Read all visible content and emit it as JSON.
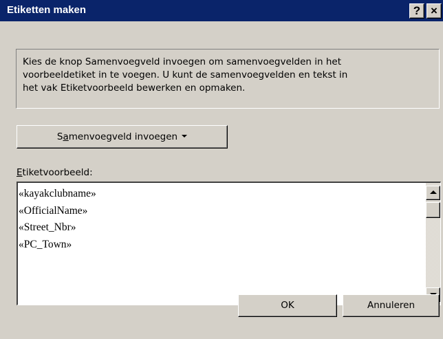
{
  "window": {
    "title": "Etiketten maken",
    "help_label": "?",
    "close_label": "×"
  },
  "info": {
    "text": "Kies de knop Samenvoegveld invoegen om samenvoegvelden in het\nvoorbeeldetiket in te voegen. U kunt de samenvoegvelden en tekst in\nhet vak Etiketvoorbeeld bewerken en opmaken."
  },
  "merge_button": {
    "label_prefix": "S",
    "label_mnemonic": "a",
    "label_rest": "menvoegveld invoegen",
    "icon": "chevron-down-icon"
  },
  "preview": {
    "label_mnemonic": "E",
    "label_rest": "tiketvoorbeeld:",
    "lines": [
      "«kayakclubname»",
      "«OfficialName»",
      "«Street_Nbr»",
      "«PC_Town»"
    ]
  },
  "buttons": {
    "ok": "OK",
    "cancel": "Annuleren"
  },
  "colors": {
    "titlebar": "#0a246a",
    "dialog": "#d4d0c8"
  }
}
